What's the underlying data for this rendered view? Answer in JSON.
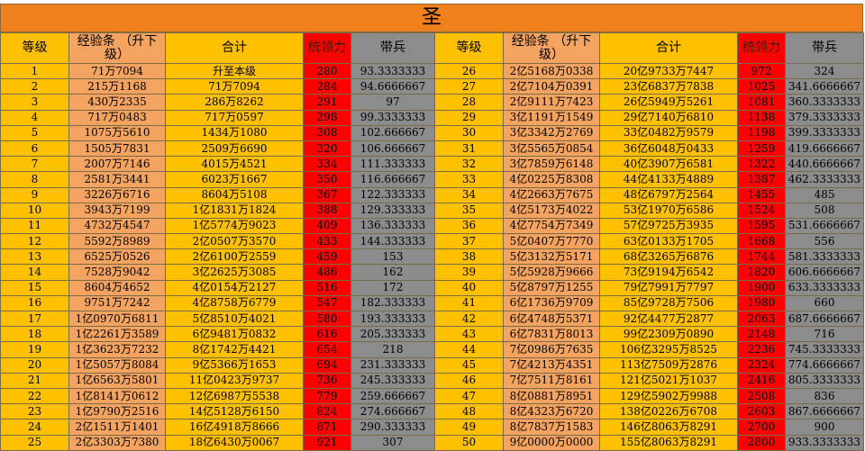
{
  "title": "圣",
  "headers": [
    "等级",
    "经验条 （升下级）",
    "合计",
    "统领力",
    "带兵"
  ],
  "rows": [
    {
      "left": [
        "1",
        "71万7094",
        "升至本级",
        "280",
        "93.3333333"
      ],
      "right": [
        "26",
        "2亿5168万0338",
        "20亿9733万7447",
        "972",
        "324"
      ]
    },
    {
      "left": [
        "2",
        "215万1168",
        "71万7094",
        "284",
        "94.6666667"
      ],
      "right": [
        "27",
        "2亿7104万0391",
        "23亿6837万7838",
        "1025",
        "341.6666667"
      ]
    },
    {
      "left": [
        "3",
        "430万2335",
        "286万8262",
        "291",
        "97"
      ],
      "right": [
        "28",
        "2亿9111万7423",
        "26亿5949万5261",
        "1081",
        "360.3333333"
      ]
    },
    {
      "left": [
        "4",
        "717万0483",
        "717万0597",
        "298",
        "99.3333333"
      ],
      "right": [
        "29",
        "3亿1191万1549",
        "29亿7140万6810",
        "1138",
        "379.3333333"
      ]
    },
    {
      "left": [
        "5",
        "1075万5610",
        "1434万1080",
        "308",
        "102.666667"
      ],
      "right": [
        "30",
        "3亿3342万2769",
        "33亿0482万9579",
        "1198",
        "399.3333333"
      ]
    },
    {
      "left": [
        "6",
        "1505万7831",
        "2509万6690",
        "320",
        "106.666667"
      ],
      "right": [
        "31",
        "3亿5565万0854",
        "36亿6048万0433",
        "1259",
        "419.6666667"
      ]
    },
    {
      "left": [
        "7",
        "2007万7146",
        "4015万4521",
        "334",
        "111.333333"
      ],
      "right": [
        "32",
        "3亿7859万6148",
        "40亿3907万6581",
        "1322",
        "440.6666667"
      ]
    },
    {
      "left": [
        "8",
        "2581万3441",
        "6023万1667",
        "350",
        "116.666667"
      ],
      "right": [
        "33",
        "4亿0225万8308",
        "44亿4133万4889",
        "1387",
        "462.3333333"
      ]
    },
    {
      "left": [
        "9",
        "3226万6716",
        "8604万5108",
        "367",
        "122.333333"
      ],
      "right": [
        "34",
        "4亿2663万7675",
        "48亿6797万2564",
        "1455",
        "485"
      ]
    },
    {
      "left": [
        "10",
        "3943万7199",
        "1亿1831万1824",
        "388",
        "129.333333"
      ],
      "right": [
        "35",
        "4亿5173万4022",
        "53亿1970万6586",
        "1524",
        "508"
      ]
    },
    {
      "left": [
        "11",
        "4732万4547",
        "1亿5774万9023",
        "409",
        "136.333333"
      ],
      "right": [
        "36",
        "4亿7754万7349",
        "57亿9725万3935",
        "1595",
        "531.6666667"
      ]
    },
    {
      "left": [
        "12",
        "5592万8989",
        "2亿0507万3570",
        "433",
        "144.333333"
      ],
      "right": [
        "37",
        "5亿0407万7770",
        "63亿0133万1705",
        "1668",
        "556"
      ]
    },
    {
      "left": [
        "13",
        "6525万0526",
        "2亿6100万2559",
        "459",
        "153"
      ],
      "right": [
        "38",
        "5亿3132万5171",
        "68亿3265万6876",
        "1744",
        "581.3333333"
      ]
    },
    {
      "left": [
        "14",
        "7528万9042",
        "3亿2625万3085",
        "486",
        "162"
      ],
      "right": [
        "39",
        "5亿5928万9666",
        "73亿9194万6542",
        "1820",
        "606.6666667"
      ]
    },
    {
      "left": [
        "15",
        "8604万4652",
        "4亿0154万2127",
        "516",
        "172"
      ],
      "right": [
        "40",
        "5亿8797万1255",
        "79亿7991万7797",
        "1900",
        "633.3333333"
      ]
    },
    {
      "left": [
        "16",
        "9751万7242",
        "4亿8758万6779",
        "547",
        "182.333333"
      ],
      "right": [
        "41",
        "6亿1736万9709",
        "85亿9728万7506",
        "1980",
        "660"
      ]
    },
    {
      "left": [
        "17",
        "1亿0970万6811",
        "5亿8510万4021",
        "580",
        "193.333333"
      ],
      "right": [
        "42",
        "6亿4748万5371",
        "92亿4477万2877",
        "2063",
        "687.6666667"
      ]
    },
    {
      "left": [
        "18",
        "1亿2261万3589",
        "6亿9481万0832",
        "616",
        "205.333333"
      ],
      "right": [
        "43",
        "6亿7831万8013",
        "99亿2309万0890",
        "2148",
        "716"
      ]
    },
    {
      "left": [
        "19",
        "1亿3623万7232",
        "8亿1742万4421",
        "654",
        "218"
      ],
      "right": [
        "44",
        "7亿0986万7635",
        "106亿3295万8525",
        "2236",
        "745.3333333"
      ]
    },
    {
      "left": [
        "20",
        "1亿5057万8084",
        "9亿5366万1653",
        "694",
        "231.333333"
      ],
      "right": [
        "45",
        "7亿4213万4351",
        "113亿7509万2876",
        "2324",
        "774.6666667"
      ]
    },
    {
      "left": [
        "21",
        "1亿6563万5801",
        "11亿0423万9737",
        "736",
        "245.333333"
      ],
      "right": [
        "46",
        "7亿7511万8161",
        "121亿5021万1037",
        "2416",
        "805.3333333"
      ]
    },
    {
      "left": [
        "22",
        "1亿8141万0612",
        "12亿6987万5538",
        "779",
        "259.666667"
      ],
      "right": [
        "47",
        "8亿0881万8951",
        "129亿5902万9988",
        "2508",
        "836"
      ]
    },
    {
      "left": [
        "23",
        "1亿9790万2516",
        "14亿5128万6150",
        "824",
        "274.666667"
      ],
      "right": [
        "48",
        "8亿4323万6720",
        "138亿0226万6708",
        "2603",
        "867.6666667"
      ]
    },
    {
      "left": [
        "24",
        "2亿1511万1401",
        "16亿4918万8666",
        "871",
        "290.333333"
      ],
      "right": [
        "49",
        "8亿7837万1583",
        "146亿8063万8291",
        "2700",
        "900"
      ]
    },
    {
      "left": [
        "25",
        "2亿3303万7380",
        "18亿6430万0067",
        "921",
        "307"
      ],
      "right": [
        "50",
        "9亿0000万0000",
        "155亿8063万8291",
        "2800",
        "933.3333333"
      ]
    }
  ]
}
